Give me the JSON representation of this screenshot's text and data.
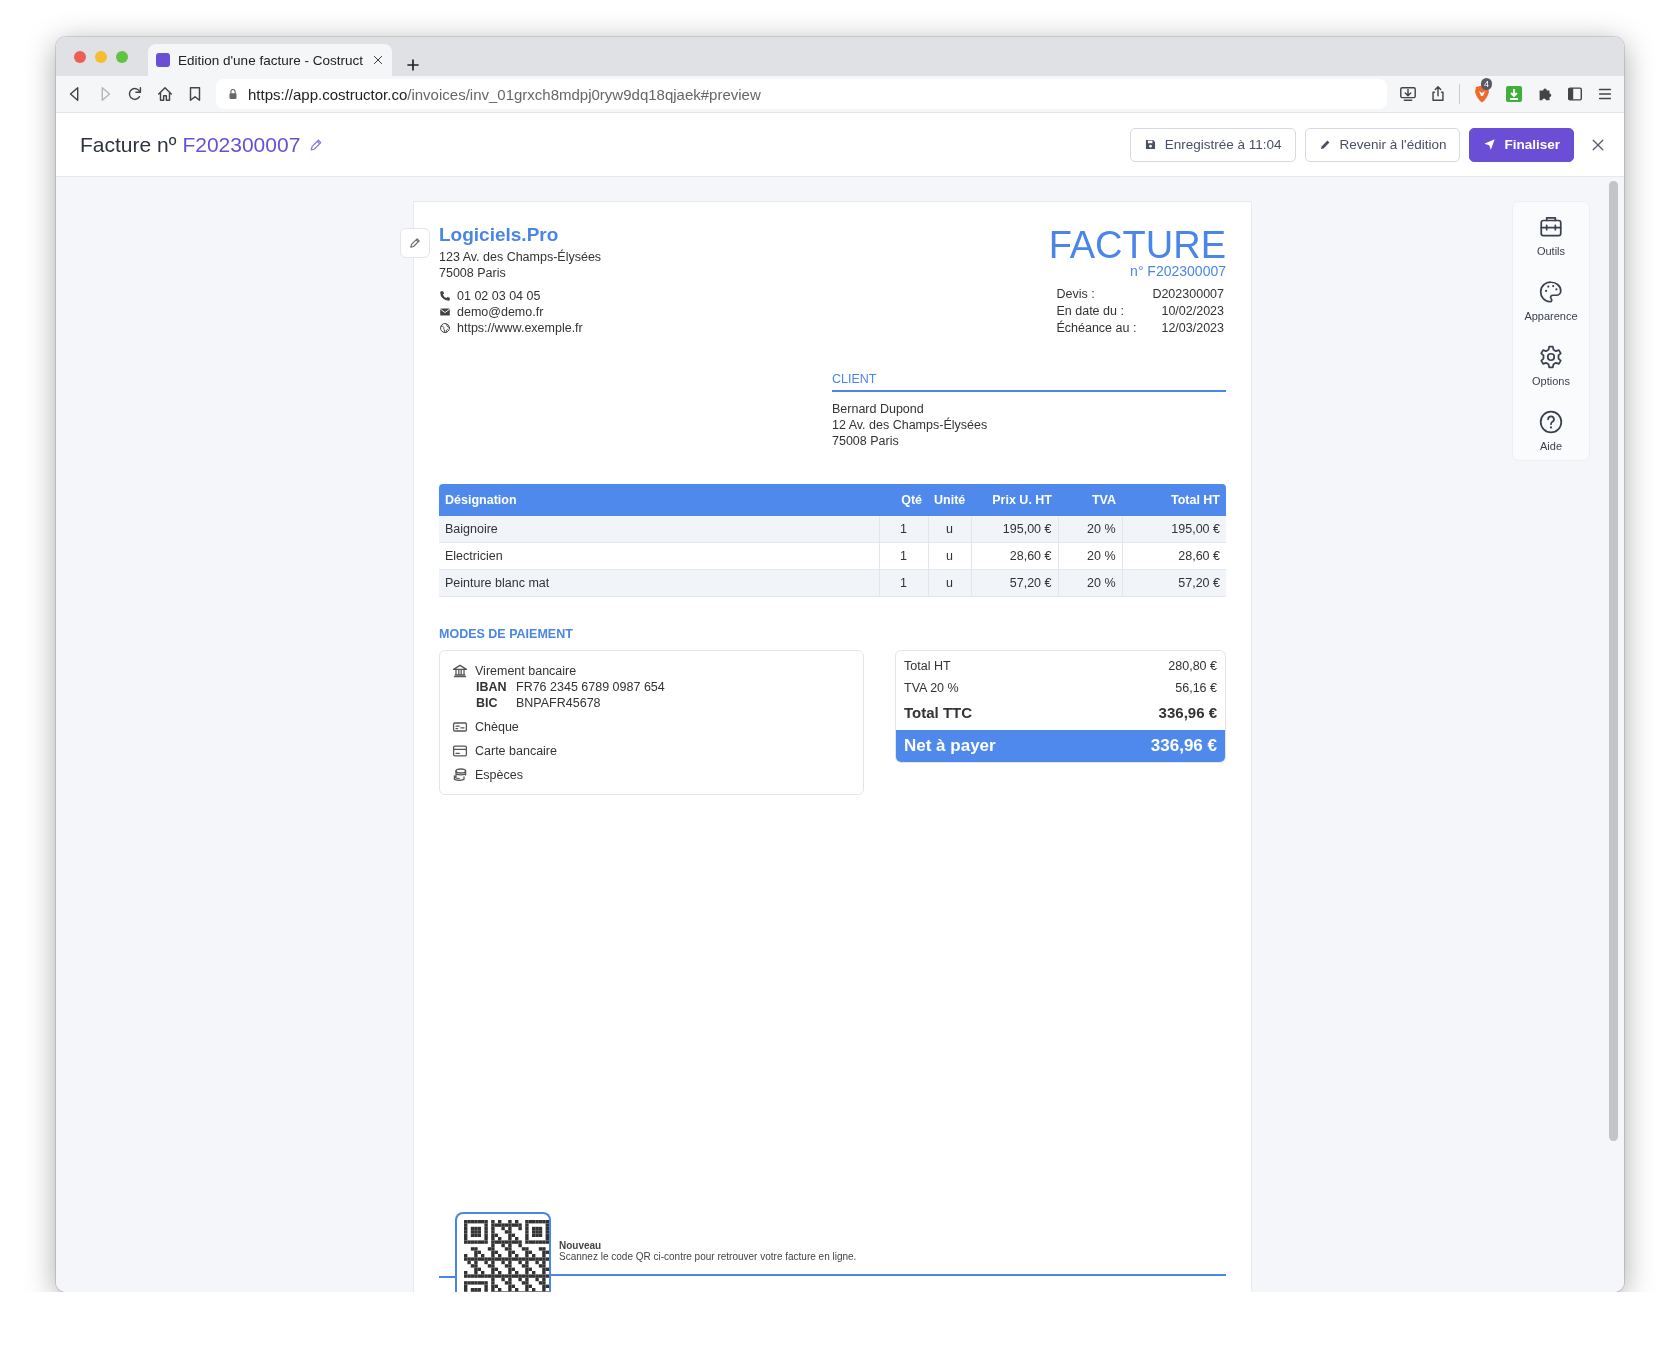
{
  "browser": {
    "tab_title": "Edition d'une facture - Costruct",
    "url_host": "https://app.costructor.co",
    "url_path": "/invoices/inv_01grxch8mdpj0ryw9dq18qjaek#preview",
    "extension_badge": "4"
  },
  "header": {
    "title": "Facture nº",
    "number": "F202300007",
    "buttons": [
      {
        "kind": "saved",
        "label": "Enregistrée à 11:04"
      },
      {
        "kind": "edit",
        "label": "Revenir à l'édition"
      },
      {
        "kind": "primary",
        "label": "Finaliser"
      }
    ]
  },
  "invoice": {
    "company": {
      "name": "Logiciels.Pro",
      "address": [
        "123 Av. des Champs-Élysées",
        "75008 Paris"
      ],
      "contacts": [
        {
          "kind": "phone",
          "text": "01 02 03 04 05"
        },
        {
          "kind": "email",
          "text": "demo@demo.fr"
        },
        {
          "kind": "web",
          "text": "https://www.exemple.fr"
        }
      ]
    },
    "title": "FACTURE",
    "number": "n° F202300007",
    "meta": [
      {
        "label": "Devis :",
        "value": "D202300007"
      },
      {
        "label": "En date du :",
        "value": "10/02/2023"
      },
      {
        "label": "Échéance au :",
        "value": "12/03/2023"
      }
    ],
    "client": {
      "heading": "CLIENT",
      "lines": [
        "Bernard Dupond",
        "12 Av. des Champs-Élysées",
        "75008 Paris"
      ]
    },
    "table": {
      "columns": [
        "Désignation",
        "Qté",
        "Unité",
        "Prix U. HT",
        "TVA",
        "Total HT"
      ],
      "rows": [
        [
          "Baignoire",
          "1",
          "u",
          "195,00 €",
          "20 %",
          "195,00 €"
        ],
        [
          "Electricien",
          "1",
          "u",
          "28,60 €",
          "20 %",
          "28,60 €"
        ],
        [
          "Peinture blanc mat",
          "1",
          "u",
          "57,20 €",
          "20 %",
          "57,20 €"
        ]
      ]
    },
    "payment": {
      "heading": "MODES DE PAIEMENT",
      "methods": [
        {
          "kind": "bank",
          "label": "Virement bancaire",
          "details": [
            {
              "label": "IBAN",
              "value": "FR76 2345 6789 0987 654"
            },
            {
              "label": "BIC",
              "value": "BNPAFR45678"
            }
          ]
        },
        {
          "kind": "cheque",
          "label": "Chèque"
        },
        {
          "kind": "card",
          "label": "Carte bancaire"
        },
        {
          "kind": "cash",
          "label": "Espèces"
        }
      ]
    },
    "totals": [
      {
        "kind": "sub",
        "label": "Total HT",
        "value": "280,80 €"
      },
      {
        "kind": "sub",
        "label": "TVA 20 %",
        "value": "56,16 €"
      },
      {
        "kind": "total",
        "label": "Total TTC",
        "value": "336,96 €"
      },
      {
        "kind": "due",
        "label": "Net à payer",
        "value": "336,96 €"
      }
    ],
    "footer": {
      "title": "Nouveau",
      "text": "Scannez le code QR ci-contre pour retrouver votre facture en ligne."
    }
  },
  "tools": [
    {
      "kind": "toolbox",
      "label": "Outils"
    },
    {
      "kind": "palette",
      "label": "Apparence"
    },
    {
      "kind": "gear",
      "label": "Options"
    },
    {
      "kind": "help",
      "label": "Aide"
    }
  ]
}
